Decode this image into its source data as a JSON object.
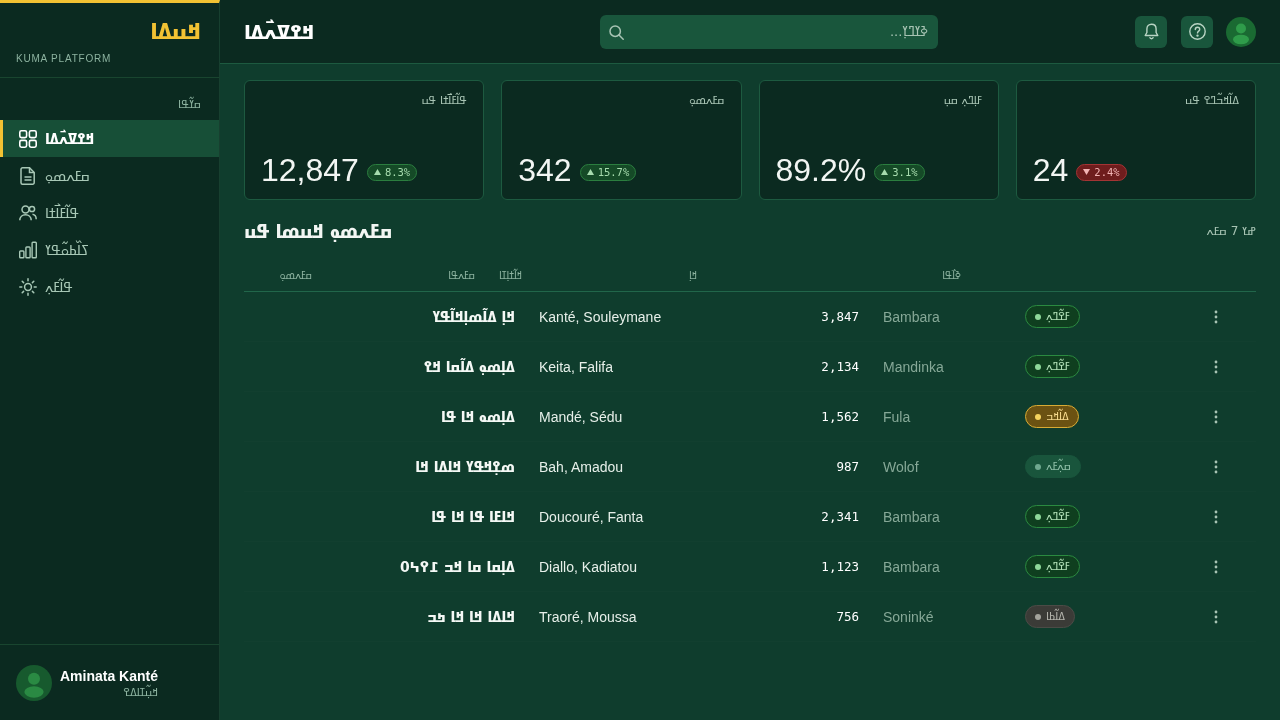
{
  "sidebar": {
    "logo": "ߞߎߡߊ",
    "subtitle": "KUMA PLATFORM",
    "section_label": "ߛߌ߬ߟߊ",
    "items": [
      {
        "label": "ߞߐߜߍ߯ߡߊ",
        "selected": true
      },
      {
        "label": "ߛߓߍߘߋ߲",
        "selected": false
      },
      {
        "label": "ߟߊ߬ߓߊ߯ߙߊ",
        "selected": false
      },
      {
        "label": "ߖߊ߰ߕߋ߬ߟߌ",
        "selected": false
      },
      {
        "label": "ߟߊ߬ߓߍ߲",
        "selected": false
      }
    ],
    "user": {
      "name": "Aminata Kanté",
      "role": "ߞߎ߲߬ߠߊߡߐ"
    }
  },
  "header": {
    "title": "ߞߐߜߍ߯ߡߊ",
    "search": {
      "placeholder": "ߢߌߣߌ߲..."
    }
  },
  "stats": [
    {
      "label": "ߡߊ߬ߞߏ߬ߣߐ ߟߎ",
      "value": "24",
      "change": "2.4%",
      "falling": true
    },
    {
      "label": "ߓߊ߲ߣߍ߲ ߛߎ߲",
      "value": "89.2%",
      "change": "3.1%",
      "falling": false
    },
    {
      "label": "ߛߓߍߘߋ߲",
      "value": "342",
      "change": "15.7%",
      "falling": false
    },
    {
      "label": "ߟߊ߬ߓߊ߯ߙߊ ߟߎ",
      "value": "12,847",
      "change": "8.3%",
      "falling": false
    }
  ],
  "documents": {
    "title": "ߛߓߍߘߋ߲ ߞߎߘߊ ߟߎ",
    "count": "ߝߌ 7 ߛߓߍ",
    "columns": [
      "ߢߊ߯ߟߊ",
      "ߞߊ߲",
      "ߞߊ߬ߙߊ߲ߠߊ",
      "ߛߓߍߟߊ",
      "ߛߓߍߘߋ߲"
    ],
    "rows": [
      {
        "title": "ߞߊ߲ ߡߊ߬ߘߊ߲ߞߊ߬ߟߌ",
        "author": "Kanté, Souleymane",
        "reads": "3,847",
        "language": "Bambara",
        "status": {
          "label": "ߓߐ߬ߣߍ߲",
          "color": "#8fd89a"
        }
      },
      {
        "title": "ߡߊ߲ߘߋ߲ ߡߊ߬ߛߊ ߞߐ",
        "author": "Keita, Falifa",
        "reads": "2,134",
        "language": "Mandinka",
        "status": {
          "label": "ߓߐ߬ߣߍ߲",
          "color": "#8fd89a"
        }
      },
      {
        "title": "ߡߊ߲ߘߋ ߞߊ ߟߊ",
        "author": "Mandé, Sédu",
        "reads": "1,562",
        "language": "Fula",
        "status": {
          "label": "ߡߊ߬ߞߏ",
          "color": "#f5d35e"
        }
      },
      {
        "title": "ߘߐ߲ߞߟߌ ߞߊߡߊ ߞߊ",
        "author": "Bah, Amadou",
        "reads": "987",
        "language": "Wolof",
        "status": {
          "label": "ߛߍ߲߬ߓߍ",
          "color": "#6fa88f"
        }
      },
      {
        "title": "ߞߊߓߊ ߟߊ ߞߊ ߟߊ",
        "author": "Doucouré, Fanta",
        "reads": "2,341",
        "language": "Bambara",
        "status": {
          "label": "ߓߐ߬ߣߍ߲",
          "color": "#8fd89a"
        }
      },
      {
        "title": "ߡߊ߲ߛߊ ߛߊ ߞߏ ߁߉߆߀",
        "author": "Diallo, Kadiatou",
        "reads": "1,123",
        "language": "Bambara",
        "status": {
          "label": "ߓߐ߬ߣߍ߲",
          "color": "#8fd89a"
        }
      },
      {
        "title": "ߞߊߡߊ ߞߊ ߞߊ ߤߏ",
        "author": "Traoré, Moussa",
        "reads": "756",
        "language": "Soninké",
        "status": {
          "label": "ߡߊ߬ߕߊ",
          "color": "#a3a39c"
        }
      }
    ]
  }
}
